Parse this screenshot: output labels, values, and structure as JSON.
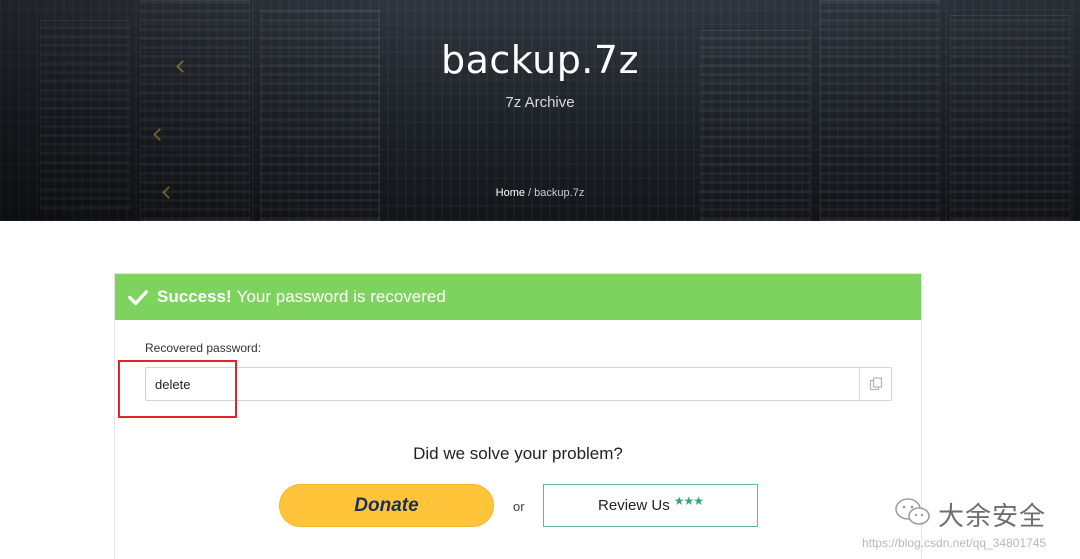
{
  "hero": {
    "title": "backup.7z",
    "subtitle": "7z Archive",
    "breadcrumb": {
      "home": "Home",
      "separator": " / ",
      "current": "backup.7z"
    }
  },
  "alert": {
    "strong": "Success!",
    "message": "Your password is recovered",
    "color": "#7ed35e",
    "icon": "check-icon"
  },
  "password": {
    "label": "Recovered password:",
    "value": "delete",
    "copy_icon": "copy-icon"
  },
  "feedback": {
    "question": "Did we solve your problem?",
    "donate_label": "Donate",
    "or_label": "or",
    "review_label": "Review Us",
    "review_stars": "★★★"
  },
  "watermark": {
    "brand": "大余安全",
    "url": "https://blog.csdn.net/qq_34801745",
    "icon": "wechat-icon"
  },
  "colors": {
    "success_green": "#7ed35e",
    "donate_yellow": "#ffc439",
    "donate_text": "#1c2f5a",
    "review_border": "#61b995",
    "highlight_red": "#e0262b"
  }
}
